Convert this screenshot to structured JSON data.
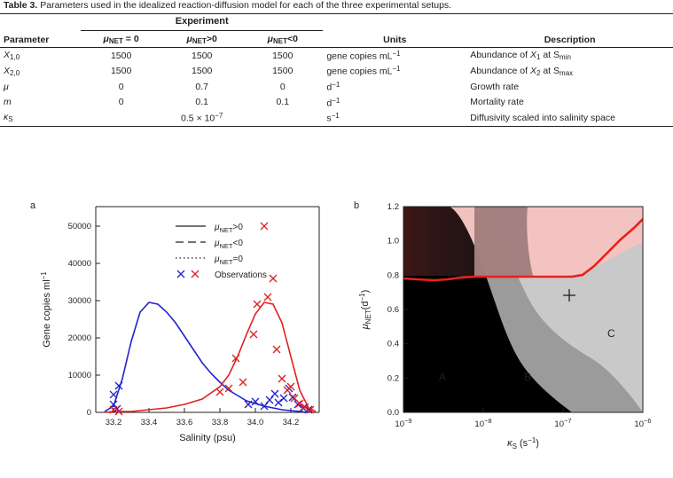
{
  "table": {
    "caption_bold": "Table 3.",
    "caption_text": "Parameters used in the idealized reaction-diffusion model for each of the three experimental setups.",
    "group_header": "Experiment",
    "columns": {
      "parameter": "Parameter",
      "exp1": "μNET = 0",
      "exp2": "μNET>0",
      "exp3": "μNET<0",
      "units": "Units",
      "description": "Description"
    },
    "rows": [
      {
        "param": "X1,0",
        "exp1": "1500",
        "exp2": "1500",
        "exp3": "1500",
        "units": "gene copies mL−1",
        "desc": "Abundance of X1 at Smin"
      },
      {
        "param": "X2,0",
        "exp1": "1500",
        "exp2": "1500",
        "exp3": "1500",
        "units": "gene copies mL−1",
        "desc": "Abundance of X2 at Smax"
      },
      {
        "param": "μ",
        "exp1": "0",
        "exp2": "0.7",
        "exp3": "0",
        "units": "d−1",
        "desc": "Growth rate"
      },
      {
        "param": "m",
        "exp1": "0",
        "exp2": "0.1",
        "exp3": "0.1",
        "units": "d−1",
        "desc": "Mortality rate"
      },
      {
        "param": "κS",
        "value": "0.5 × 10−7",
        "units": "s−1",
        "desc": "Diffusivity scaled into salinity space"
      }
    ]
  },
  "figure": {
    "panel_a": {
      "label": "a",
      "xlabel": "Salinity (psu)",
      "ylabel": "Gene copies ml−1",
      "xticks": [
        "33.2",
        "33.4",
        "33.6",
        "33.8",
        "34.0",
        "34.2"
      ],
      "yticks": [
        "0",
        "10000",
        "20000",
        "30000",
        "40000",
        "50000"
      ],
      "xlim": [
        33.1,
        34.35
      ],
      "ylim": [
        0,
        52000
      ],
      "legend": [
        {
          "style": "solid",
          "label": "μNET>0"
        },
        {
          "style": "dashed",
          "label": "μNET<0"
        },
        {
          "style": "dotted",
          "label": "μNET=0"
        },
        {
          "style": "markers",
          "label": "Observations"
        }
      ]
    },
    "panel_b": {
      "label": "b",
      "xlabel": "κS (s−1)",
      "ylabel": "μNET (d−1)",
      "xticks": [
        "10−9",
        "10−8",
        "10−7",
        "10−6"
      ],
      "yticks": [
        "0.0",
        "0.2",
        "0.4",
        "0.6",
        "0.8",
        "1.0",
        "1.2"
      ],
      "regions": [
        {
          "name": "A",
          "color": "#000000"
        },
        {
          "name": "B",
          "color": "#9b9b9b"
        },
        {
          "name": "C",
          "color": "#c9c9c9"
        }
      ],
      "marker": "+",
      "threshold_color": "#e8211c",
      "upper_region_color": "#f6c3c2"
    },
    "colors": {
      "series_blue": "#2222cc",
      "series_red": "#e02020",
      "ink": "#231f20"
    }
  },
  "chart_data": [
    {
      "type": "line",
      "title": "",
      "xlabel": "Salinity (psu)",
      "ylabel": "Gene copies ml^-1",
      "xlim": [
        33.1,
        34.35
      ],
      "ylim": [
        0,
        52000
      ],
      "grid": false,
      "series": [
        {
          "name": "X1 model (blue)",
          "color": "#2222cc",
          "x": [
            33.15,
            33.2,
            33.25,
            33.3,
            33.35,
            33.4,
            33.45,
            33.5,
            33.55,
            33.6,
            33.65,
            33.7,
            33.75,
            33.8,
            33.85,
            33.9,
            33.95,
            34.0,
            34.05,
            34.1,
            34.15,
            34.2,
            34.25,
            34.3
          ],
          "y": [
            200,
            1500,
            9000,
            19000,
            27000,
            29500,
            29000,
            27000,
            24000,
            20500,
            17000,
            13500,
            10500,
            8000,
            6000,
            4500,
            3200,
            2300,
            1600,
            1100,
            700,
            450,
            250,
            120
          ]
        },
        {
          "name": "X2 model (red)",
          "color": "#e02020",
          "x": [
            33.15,
            33.2,
            33.3,
            33.4,
            33.5,
            33.6,
            33.7,
            33.8,
            33.85,
            33.9,
            33.95,
            34.0,
            34.05,
            34.1,
            34.15,
            34.2,
            34.25,
            34.3
          ],
          "y": [
            100,
            150,
            300,
            600,
            1100,
            2000,
            3500,
            7000,
            10000,
            15000,
            21000,
            26500,
            29400,
            29000,
            24000,
            15000,
            6000,
            1200
          ]
        }
      ],
      "scatter": [
        {
          "name": "Observations (blue)",
          "color": "#2222cc",
          "marker": "x",
          "x": [
            33.2,
            33.2,
            33.22,
            33.25,
            33.95,
            34.0,
            34.05,
            34.08,
            34.1,
            34.12,
            34.15,
            34.18,
            34.2,
            34.22,
            34.25,
            34.27
          ],
          "y": [
            4800,
            2200,
            900,
            7000,
            2000,
            2600,
            1500,
            3200,
            5000,
            2500,
            3500,
            6500,
            4000,
            2000,
            1200,
            800
          ]
        },
        {
          "name": "Observations (red)",
          "color": "#e02020",
          "marker": "x",
          "x": [
            33.2,
            33.25,
            33.8,
            33.85,
            33.9,
            33.95,
            34.0,
            34.02,
            34.05,
            34.07,
            34.1,
            34.12,
            34.15,
            34.18,
            34.2,
            34.22,
            34.25,
            34.27,
            34.3
          ],
          "y": [
            600,
            300,
            5500,
            6500,
            14500,
            8000,
            21000,
            29500,
            50000,
            31000,
            36000,
            17000,
            9000,
            6000,
            7000,
            4000,
            2500,
            1500,
            900
          ]
        }
      ]
    },
    {
      "type": "heatmap",
      "title": "",
      "xlabel": "kappa_S (s^-1)",
      "ylabel": "mu_NET (d^-1)",
      "xlim": [
        1e-09,
        1e-06
      ],
      "ylim": [
        0.0,
        1.2
      ],
      "xscale": "log",
      "grid": false,
      "annotations": [
        "A",
        "B",
        "C",
        "+"
      ],
      "threshold_curve": {
        "name": "regime boundary (red)",
        "x": [
          1e-09,
          2e-09,
          5e-09,
          1e-08,
          3e-08,
          1e-07,
          3e-07,
          5e-07,
          7e-07,
          1e-06
        ],
        "y": [
          0.78,
          0.775,
          0.77,
          0.76,
          0.755,
          0.755,
          0.76,
          0.82,
          0.95,
          1.13
        ]
      },
      "ab_boundary": {
        "x": [
          1e-09,
          3e-09,
          8e-09,
          2e-08,
          5e-08,
          1e-07,
          2e-07,
          4e-07,
          1e-06
        ],
        "y_top": [
          1.2,
          1.2,
          1.2,
          1.1,
          0.85,
          0.6,
          0.35,
          0.2,
          0.12
        ]
      },
      "marker_point": {
        "x": 1.2e-07,
        "y": 0.68
      }
    }
  ]
}
